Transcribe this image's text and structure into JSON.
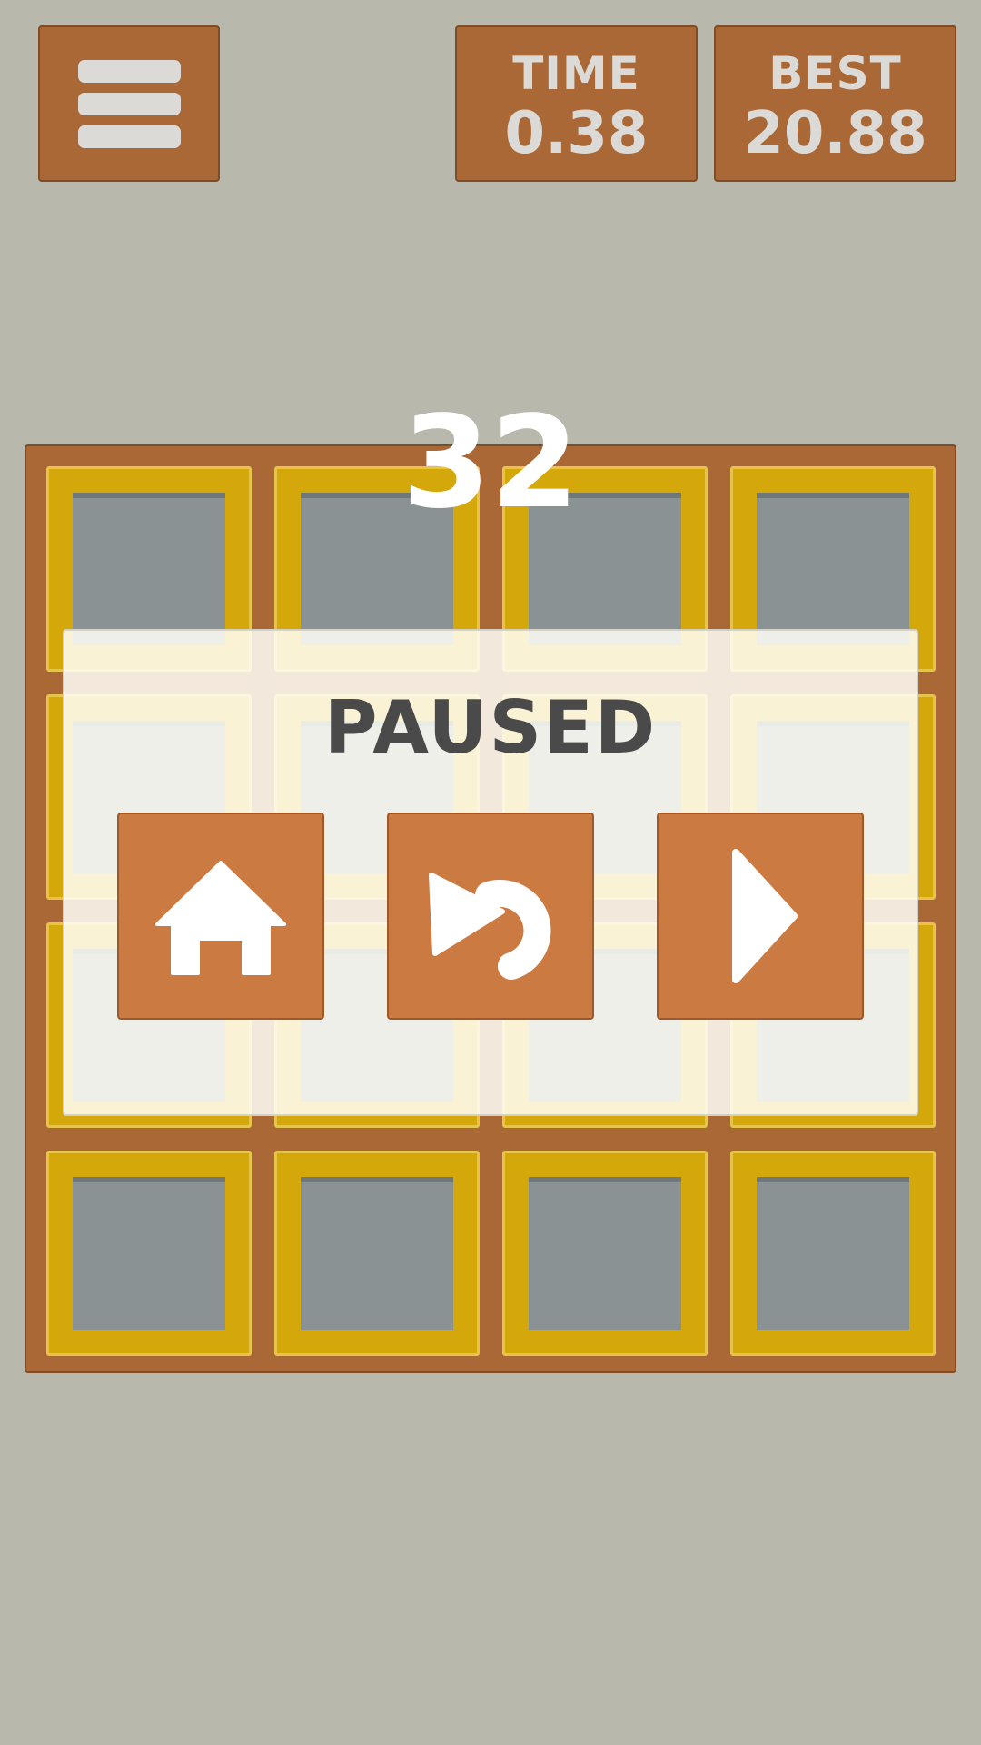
{
  "header": {
    "menu_icon": "hamburger-menu-icon",
    "time_label": "TIME",
    "time_value": "0.38",
    "best_label": "BEST",
    "best_value": "20.88"
  },
  "game": {
    "score": "32",
    "grid": {
      "rows": 4,
      "cols": 4
    }
  },
  "pause_menu": {
    "title": "PAUSED",
    "buttons": [
      {
        "icon": "home-icon"
      },
      {
        "icon": "restart-icon"
      },
      {
        "icon": "play-icon"
      }
    ]
  },
  "colors": {
    "background": "#b8b8ac",
    "panel": "#a96836",
    "tile_border": "#d4a80a",
    "tile_inner": "#8a9294",
    "action_button": "#cb7a42",
    "text_light": "#dcdad6",
    "paused_text": "#4a4a4a"
  }
}
